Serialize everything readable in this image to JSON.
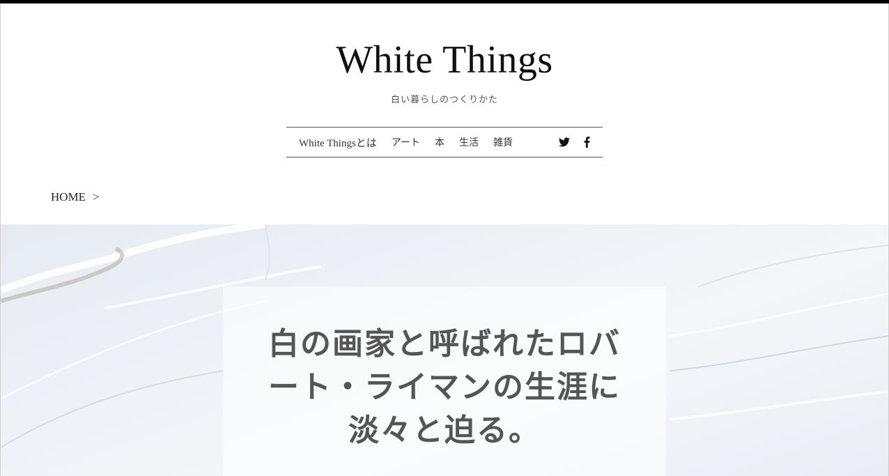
{
  "site": {
    "title": "White Things",
    "tagline": "白い暮らしのつくりかた"
  },
  "nav": {
    "items": [
      {
        "label": "White Thingsとは"
      },
      {
        "label": "アート"
      },
      {
        "label": "本"
      },
      {
        "label": "生活"
      },
      {
        "label": "雑貨"
      }
    ],
    "social": [
      {
        "icon": "twitter-icon"
      },
      {
        "icon": "facebook-icon"
      }
    ]
  },
  "breadcrumb": {
    "home": "HOME",
    "separator": ">"
  },
  "article": {
    "title": "白の画家と呼ばれたロバート・ライマンの生涯に淡々と迫る。"
  },
  "colors": {
    "topbar": "#000000",
    "text": "#222222",
    "title_text": "#555555",
    "hero_bg": "#e9edf3"
  }
}
